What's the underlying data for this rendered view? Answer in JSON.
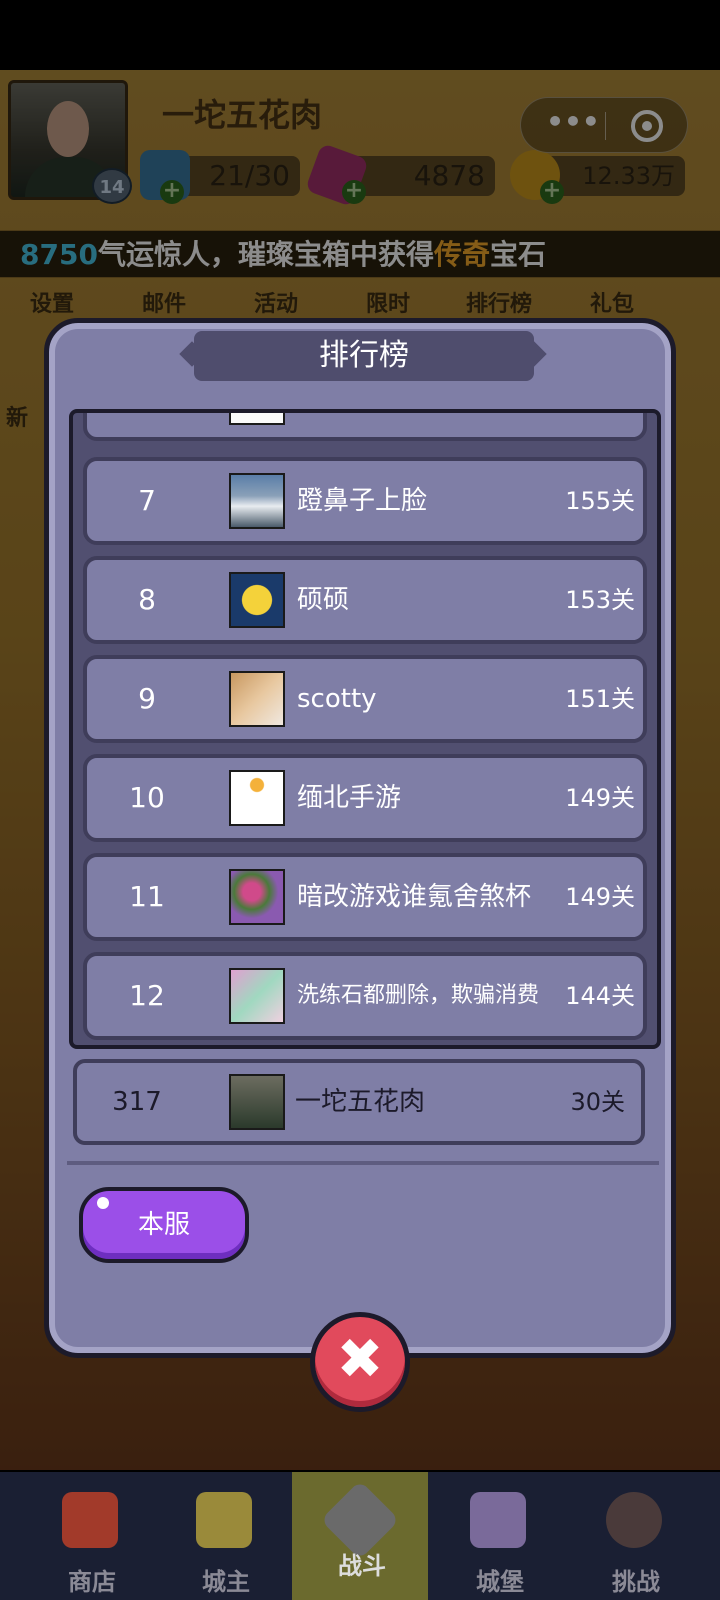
{
  "player": {
    "name": "一坨五花肉",
    "level": "14",
    "energy": "21/30",
    "gems": "4878",
    "coins": "12.33万"
  },
  "ticker": {
    "num": "8750",
    "text1": "气运惊人，璀璨宝箱中获得",
    "legend": "传奇",
    "text2": "宝石"
  },
  "menu": [
    "设置",
    "邮件",
    "活动",
    "限时",
    "排行榜",
    "礼包"
  ],
  "side_left": "新",
  "modal": {
    "title": "排行榜",
    "rows": [
      {
        "rank": "7",
        "name": "蹬鼻子上脸",
        "score": "155关"
      },
      {
        "rank": "8",
        "name": "硕硕",
        "score": "153关"
      },
      {
        "rank": "9",
        "name": "scotty",
        "score": "151关"
      },
      {
        "rank": "10",
        "name": "缅北手游",
        "score": "149关"
      },
      {
        "rank": "11",
        "name": "暗改游戏谁氪舍煞杯",
        "score": "149关"
      },
      {
        "rank": "12",
        "name": "洗练石都删除，欺骗消费",
        "score": "144关"
      }
    ],
    "self": {
      "rank": "317",
      "name": "一坨五花肉",
      "score": "30关"
    },
    "server_button": "本服",
    "close_icon": "close-x-icon"
  },
  "nav": [
    {
      "label": "商店",
      "icon": "shop-icon"
    },
    {
      "label": "城主",
      "icon": "crown-icon"
    },
    {
      "label": "战斗",
      "icon": "crossed-swords-icon"
    },
    {
      "label": "城堡",
      "icon": "castle-icon"
    },
    {
      "label": "挑战",
      "icon": "demon-icon"
    }
  ],
  "colors": {
    "accent_purple": "#9b4fe8",
    "close_red": "#e14a5c",
    "ticker_cyan": "#49c6e8",
    "ticker_orange": "#f3a82a"
  }
}
